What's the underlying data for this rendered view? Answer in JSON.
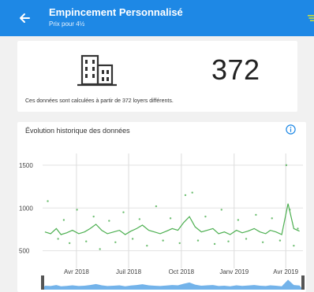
{
  "header": {
    "title": "Empincement Personnalisé",
    "subtitle": "Prix pour 4½"
  },
  "summary": {
    "count": "372",
    "note": "Ces données sont calculées à partir de 372 loyers différents."
  },
  "chart_section": {
    "title": "Évolution historique des données"
  },
  "colors": {
    "appbar": "#1e88e5",
    "accent": "#4caf50",
    "navigator": "#5aa6e6",
    "info": "#1e88e5"
  },
  "icons": {
    "back": "back-arrow-icon",
    "filter": "filter-icon",
    "building": "building-icon",
    "info": "info-icon"
  },
  "chart_data": {
    "type": "line",
    "title": "",
    "xlabel": "",
    "ylabel": "",
    "x_range": [
      "2018-02-01",
      "2019-05-01"
    ],
    "ylim": [
      350,
      1600
    ],
    "yticks": [
      500,
      1000,
      1500
    ],
    "ytick_labels": [
      "500",
      "1000",
      "1500"
    ],
    "xticks": [
      "2018-04-01",
      "2018-07-01",
      "2018-10-01",
      "2019-01-01",
      "2019-04-01"
    ],
    "xtick_labels": [
      "Avr 2018",
      "Juil 2018",
      "Oct 2018",
      "Janv 2019",
      "Avr 2019"
    ],
    "grid": true,
    "legend": "none",
    "series": [
      {
        "kind": "line",
        "x": [
          "2018-02-05",
          "2018-02-15",
          "2018-02-25",
          "2018-03-05",
          "2018-03-15",
          "2018-03-25",
          "2018-04-05",
          "2018-04-15",
          "2018-04-25",
          "2018-05-05",
          "2018-05-15",
          "2018-05-25",
          "2018-06-05",
          "2018-06-15",
          "2018-06-25",
          "2018-07-05",
          "2018-07-15",
          "2018-07-25",
          "2018-08-05",
          "2018-08-15",
          "2018-08-25",
          "2018-09-05",
          "2018-09-15",
          "2018-09-25",
          "2018-10-05",
          "2018-10-15",
          "2018-10-25",
          "2018-11-05",
          "2018-11-15",
          "2018-11-25",
          "2018-12-05",
          "2018-12-15",
          "2018-12-25",
          "2019-01-05",
          "2019-01-15",
          "2019-01-25",
          "2019-02-05",
          "2019-02-15",
          "2019-02-25",
          "2019-03-05",
          "2019-03-15",
          "2019-03-25",
          "2019-04-05",
          "2019-04-15",
          "2019-04-25"
        ],
        "y": [
          720,
          700,
          760,
          690,
          710,
          740,
          700,
          720,
          760,
          810,
          740,
          700,
          720,
          740,
          690,
          730,
          760,
          800,
          740,
          720,
          700,
          730,
          760,
          740,
          830,
          900,
          780,
          720,
          740,
          760,
          700,
          720,
          690,
          740,
          710,
          730,
          760,
          720,
          700,
          740,
          720,
          690,
          1050,
          760,
          730
        ]
      },
      {
        "kind": "scatter",
        "x": [
          "2018-02-10",
          "2018-02-28",
          "2018-03-10",
          "2018-03-20",
          "2018-04-02",
          "2018-04-18",
          "2018-05-01",
          "2018-05-12",
          "2018-05-28",
          "2018-06-08",
          "2018-06-22",
          "2018-07-08",
          "2018-07-20",
          "2018-08-02",
          "2018-08-18",
          "2018-08-30",
          "2018-09-12",
          "2018-09-28",
          "2018-10-08",
          "2018-10-20",
          "2018-10-30",
          "2018-11-12",
          "2018-11-28",
          "2018-12-10",
          "2018-12-22",
          "2019-01-08",
          "2019-01-22",
          "2019-02-08",
          "2019-02-20",
          "2019-03-08",
          "2019-03-22",
          "2019-04-02",
          "2019-04-08",
          "2019-04-15",
          "2019-04-22"
        ],
        "y": [
          1080,
          640,
          860,
          590,
          980,
          610,
          900,
          520,
          850,
          600,
          950,
          640,
          870,
          560,
          1020,
          620,
          880,
          590,
          1150,
          1180,
          620,
          900,
          580,
          980,
          610,
          860,
          640,
          920,
          600,
          880,
          620,
          1500,
          980,
          560,
          760
        ]
      }
    ]
  }
}
